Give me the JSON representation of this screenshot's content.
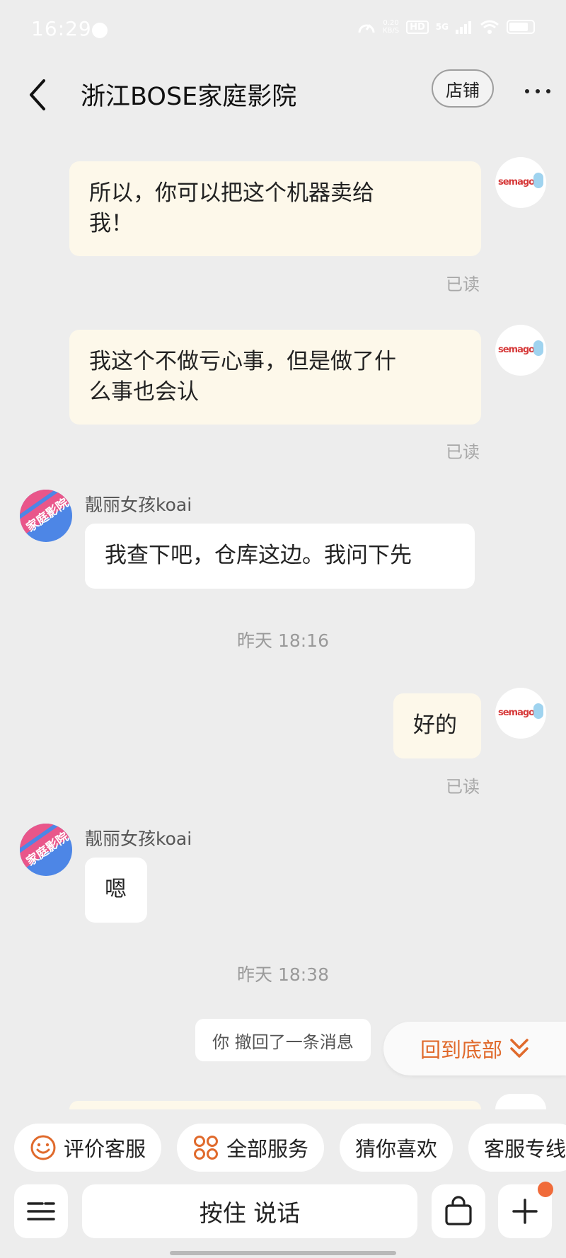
{
  "status_bar": {
    "time": "16:29",
    "speed_value": "0.20",
    "speed_unit": "KB/S",
    "hd": "HD",
    "network": "5G"
  },
  "header": {
    "title": "浙江BOSE家庭影院",
    "shop_label": "店铺"
  },
  "messages": [
    {
      "from": "me",
      "line1": "所以，你可以把这个机器卖给",
      "line2": "我！",
      "read": "已读"
    },
    {
      "from": "me",
      "line1": "我这个不做亏心事，但是做了什",
      "line2": "么事也会认",
      "read": "已读"
    },
    {
      "from": "shop",
      "sender": "靓丽女孩koai",
      "text": "我查下吧，仓库这边。我问下先"
    },
    {
      "timestamp": "昨天  18:16"
    },
    {
      "from": "me",
      "text": "好的",
      "read": "已读"
    },
    {
      "from": "shop",
      "sender": "靓丽女孩koai",
      "text": "嗯"
    },
    {
      "timestamp": "昨天  18:38"
    }
  ],
  "avatars": {
    "mine_logo": "semago",
    "shop_text": "家庭影院"
  },
  "recall_notice": "你 撤回了一条消息",
  "back_to_bottom": "回到底部",
  "quick_actions": [
    {
      "label": "评价客服",
      "icon": "smile-icon"
    },
    {
      "label": "全部服务",
      "icon": "grid-icon"
    },
    {
      "label": "猜你喜欢"
    },
    {
      "label": "客服专线"
    }
  ],
  "input_bar": {
    "voice_label": "按住 说话"
  },
  "colors": {
    "accent": "#e06a2c",
    "my_bubble": "#fdf8ea",
    "background": "#ededed"
  }
}
